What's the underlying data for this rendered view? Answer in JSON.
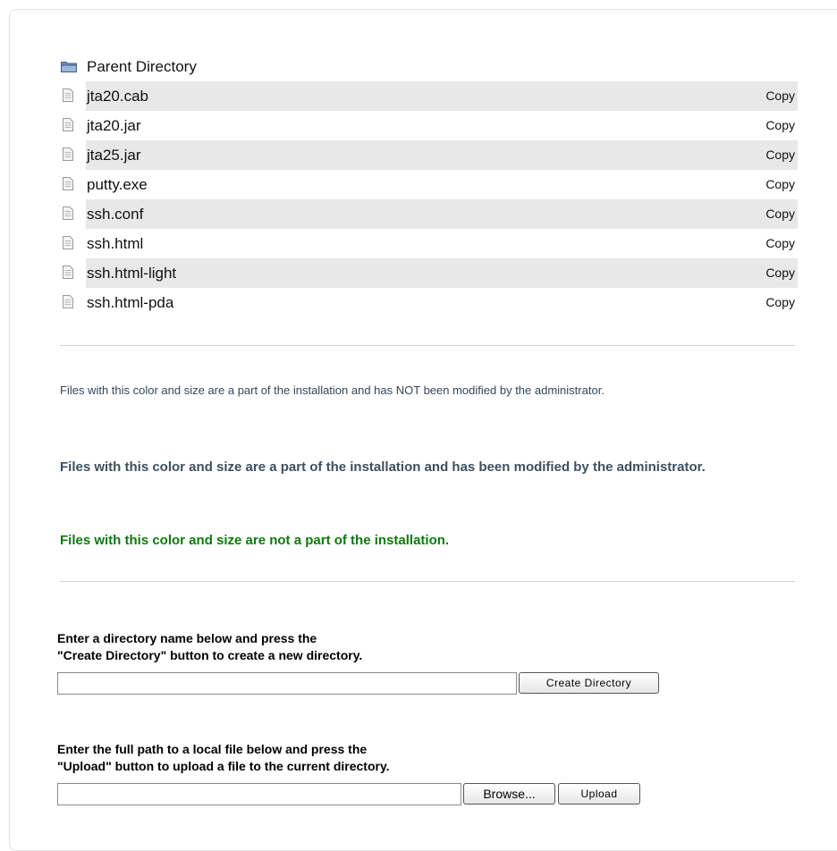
{
  "files": {
    "parent_directory": "Parent Directory",
    "items": [
      {
        "name": "jta20.cab",
        "action": "Copy"
      },
      {
        "name": "jta20.jar",
        "action": "Copy"
      },
      {
        "name": "jta25.jar",
        "action": "Copy"
      },
      {
        "name": "putty.exe",
        "action": "Copy"
      },
      {
        "name": "ssh.conf",
        "action": "Copy"
      },
      {
        "name": "ssh.html",
        "action": "Copy"
      },
      {
        "name": "ssh.html-light",
        "action": "Copy"
      },
      {
        "name": "ssh.html-pda",
        "action": "Copy"
      }
    ]
  },
  "legend": {
    "unmodified": "Files with this color and size are a part of the installation and has NOT been modified by the administrator.",
    "modified": "Files with this color and size are a part of the installation and has been modified by the administrator.",
    "not_installation": "Files with this color and size are not a part of the installation."
  },
  "create_directory": {
    "label_line1": "Enter a directory name below and press the",
    "label_line2": "\"Create Directory\" button to create a new directory.",
    "input_value": "",
    "button_label": "Create Directory"
  },
  "upload": {
    "label_line1": "Enter the full path to a local file below and press the",
    "label_line2": "\"Upload\" button to upload a file to the current directory.",
    "input_value": "",
    "browse_label": "Browse...",
    "upload_label": "Upload"
  },
  "colors": {
    "unmodified": "#33475a",
    "modified": "#3c5060",
    "not_installation": "#0c7a0c",
    "row_shade": "#e8e8e8"
  },
  "icons": {
    "parent": "folder-icon",
    "file": "file-icon"
  }
}
